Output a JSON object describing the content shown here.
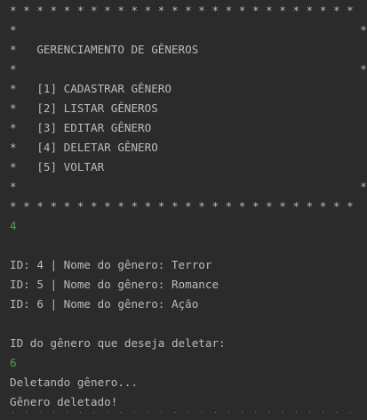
{
  "console": {
    "menu_border": "* * * * * * * * * * * * * * * * * * * * * * * * * *",
    "menu_edge": "*                                                   *",
    "menu_title": "*   GERENCIAMENTO DE GÊNEROS                          *",
    "menu_items": [
      "*   [1] CADASTRAR GÊNERO                              *",
      "*   [2] LISTAR GÊNEROS                                *",
      "*   [3] EDITAR GÊNERO                                 *",
      "*   [4] DELETAR GÊNERO                                *",
      "*   [5] VOLTAR                                        *"
    ],
    "input_option": "4",
    "list_rows": [
      "ID: 4 | Nome do gênero: Terror",
      "ID: 5 | Nome do gênero: Romance",
      "ID: 6 | Nome do gênero: Ação"
    ],
    "prompt": "ID do gênero que deseja deletar:",
    "input_id": "6",
    "status_deleting": "Deletando gênero...",
    "status_deleted": "Gênero deletado!",
    "colors": {
      "background": "#2b2b2b",
      "text": "#bbbbbb",
      "user_input": "#51a350"
    }
  }
}
